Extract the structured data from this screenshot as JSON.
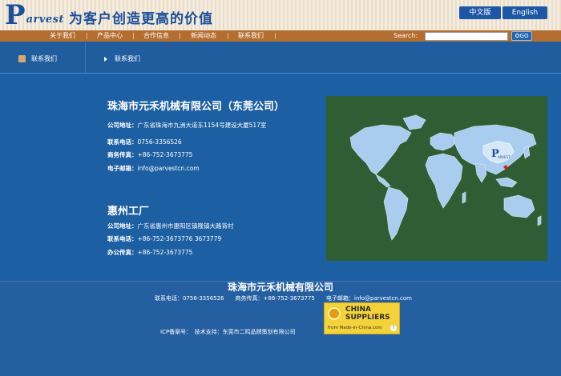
{
  "header": {
    "logo_letter": "P",
    "logo_rest": "arvest",
    "slogan": "为客户创造更高的价值",
    "lang_cn": "中文版",
    "lang_en": "English"
  },
  "nav": {
    "items": [
      "关于我们",
      "产品中心",
      "合作信息",
      "新闻动态",
      "联系我们"
    ],
    "search_label": "Search:",
    "search_value": "",
    "go_label": "GO"
  },
  "breadcrumb": {
    "left": "联系我们",
    "right": "联系我们"
  },
  "contacts": [
    {
      "title": "珠海市元禾机械有限公司（东莞公司）",
      "rows": [
        {
          "label": "公司地址：",
          "value": "广东省珠海市九洲大道东1154号建设大厦517室"
        },
        {
          "label": "联系电话：",
          "value": "0756-3356526"
        },
        {
          "label": "商务传真：",
          "value": "+86-752-3673775"
        },
        {
          "label": "电子邮箱：",
          "value": "info@parvestcn.com"
        }
      ]
    },
    {
      "title": "惠州工厂",
      "rows": [
        {
          "label": "公司地址：",
          "value": "广东省惠州市惠阳区镇隆镇大路背村"
        },
        {
          "label": "联系电话：",
          "value": "+86-752-3673776 3673779"
        },
        {
          "label": "办公传真：",
          "value": "+86-752-3673775"
        }
      ]
    }
  ],
  "map": {
    "logo_letter": "P",
    "logo_word": "ARVEST"
  },
  "footer": {
    "company": "珠海市元禾机械有限公司",
    "contact_line": "联系电话：0756-3356526　　商务传真：+86-752-3673775　　电子邮箱：info@parvestcn.com",
    "icp_line": "ICP备案号：　技术支持：东莞市二鸣品牌策划有限公司",
    "badge": {
      "line1": "CHINA",
      "line2": "SUPPLIERS",
      "sub": "from Made-in-China.com",
      "help": "?"
    }
  },
  "colors": {
    "page_blue": "#1d5fa3",
    "nav_brown": "#b36d2f",
    "map_green": "#2f5e34",
    "land_blue": "#a8cdee",
    "highlight_red": "#d92020"
  }
}
